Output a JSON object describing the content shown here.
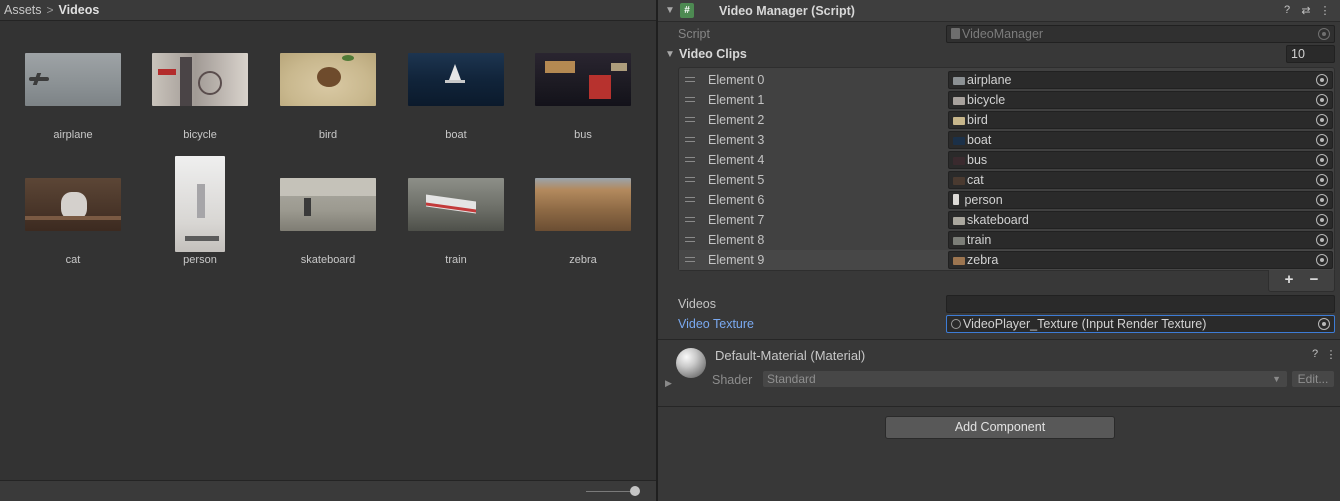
{
  "project": {
    "breadcrumb": [
      "Assets",
      "Videos"
    ],
    "separator": ">",
    "assets": [
      {
        "name": "airplane"
      },
      {
        "name": "bicycle"
      },
      {
        "name": "bird"
      },
      {
        "name": "boat"
      },
      {
        "name": "bus"
      },
      {
        "name": "cat"
      },
      {
        "name": "person"
      },
      {
        "name": "skateboard"
      },
      {
        "name": "train"
      },
      {
        "name": "zebra"
      }
    ]
  },
  "inspector": {
    "component": {
      "title": "Video Manager (Script)",
      "badge": "#",
      "icons": [
        "help-icon",
        "settings-sliders-icon",
        "more-vert-icon"
      ],
      "help_glyph": "?",
      "sliders_glyph": "⇄",
      "more_glyph": "⋮",
      "script_label": "Script",
      "script_value": "VideoManager",
      "video_clips_label": "Video Clips",
      "video_clips_count": "10",
      "elements": [
        {
          "label": "Element 0",
          "value": "airplane"
        },
        {
          "label": "Element 1",
          "value": "bicycle"
        },
        {
          "label": "Element 2",
          "value": "bird"
        },
        {
          "label": "Element 3",
          "value": "boat"
        },
        {
          "label": "Element 4",
          "value": "bus"
        },
        {
          "label": "Element 5",
          "value": "cat"
        },
        {
          "label": "Element 6",
          "value": " person"
        },
        {
          "label": "Element 7",
          "value": "skateboard"
        },
        {
          "label": "Element 8",
          "value": "train"
        },
        {
          "label": "Element 9",
          "value": "zebra"
        }
      ],
      "add_glyph": "+",
      "remove_glyph": "−",
      "videos_label": "Videos",
      "videos_value": "",
      "video_texture_label": "Video Texture",
      "video_texture_value": "VideoPlayer_Texture (Input Render Texture)"
    },
    "material": {
      "title": "Default-Material (Material)",
      "shader_label": "Shader",
      "shader_value": "Standard",
      "edit_label": "Edit...",
      "help_glyph": "?",
      "more_glyph": "⋮"
    },
    "add_component_label": "Add Component"
  },
  "colors": {
    "accent_blue": "#7aa9f0",
    "script_badge": "#4d8a52",
    "focus_border": "#3d7cd6"
  }
}
